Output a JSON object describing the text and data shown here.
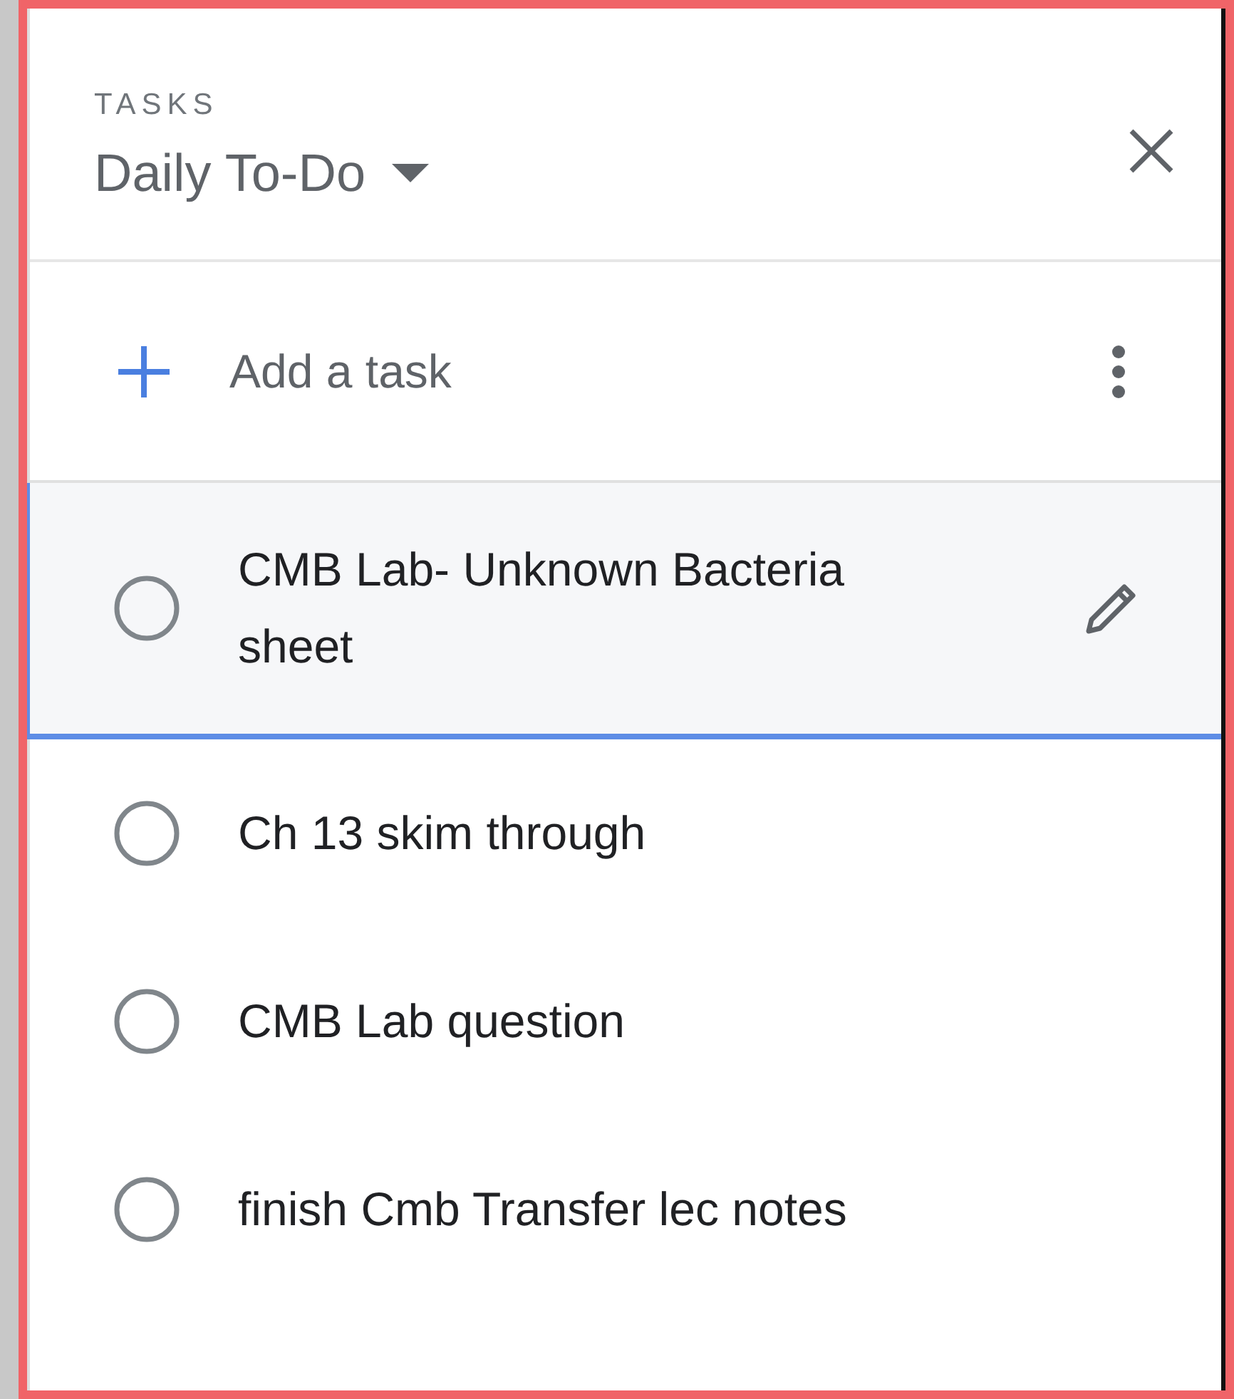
{
  "header": {
    "eyebrow": "TASKS",
    "list_title": "Daily To-Do"
  },
  "add_task": {
    "label": "Add a task"
  },
  "tasks": [
    {
      "title": "CMB Lab- Unknown Bacteria sheet",
      "checked": false,
      "selected": true
    },
    {
      "title": "Ch 13 skim through",
      "checked": false,
      "selected": false
    },
    {
      "title": "CMB Lab question",
      "checked": false,
      "selected": false
    },
    {
      "title": "finish Cmb Transfer lec notes",
      "checked": false,
      "selected": false
    }
  ]
}
